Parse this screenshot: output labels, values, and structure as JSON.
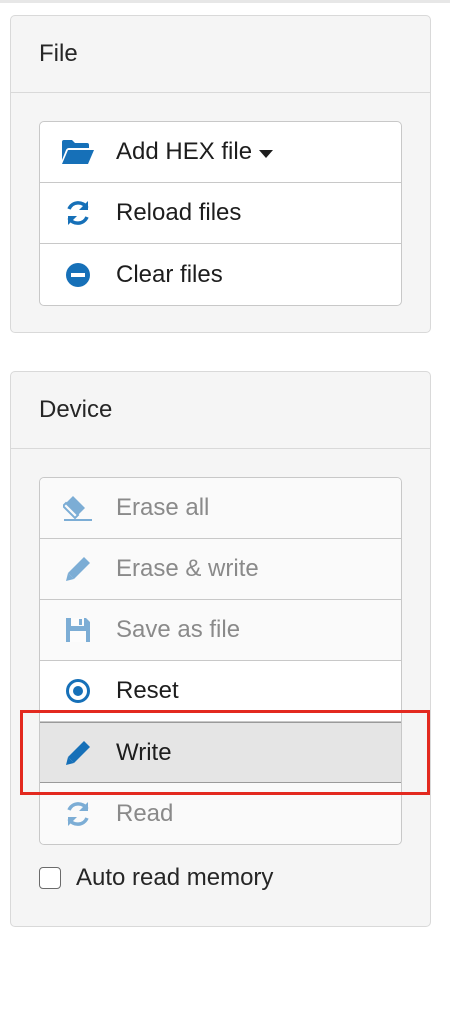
{
  "file_panel": {
    "title": "File",
    "buttons": [
      {
        "label": "Add HEX file",
        "icon": "folder-open-icon",
        "dropdown": true
      },
      {
        "label": "Reload files",
        "icon": "refresh-icon"
      },
      {
        "label": "Clear files",
        "icon": "minus-circle-icon"
      }
    ]
  },
  "device_panel": {
    "title": "Device",
    "buttons": [
      {
        "label": "Erase all",
        "icon": "eraser-icon",
        "state": "disabled"
      },
      {
        "label": "Erase & write",
        "icon": "pencil-icon",
        "state": "disabled"
      },
      {
        "label": "Save as file",
        "icon": "floppy-disk-icon",
        "state": "disabled"
      },
      {
        "label": "Reset",
        "icon": "record-icon",
        "state": "enabled"
      },
      {
        "label": "Write",
        "icon": "pencil-icon",
        "state": "active"
      },
      {
        "label": "Read",
        "icon": "refresh-icon",
        "state": "disabled"
      }
    ],
    "auto_read": {
      "label": "Auto read memory",
      "checked": false
    }
  },
  "colors": {
    "icon_blue": "#1670b8",
    "highlight_red": "#e3291f",
    "panel_bg": "#f5f5f5"
  }
}
